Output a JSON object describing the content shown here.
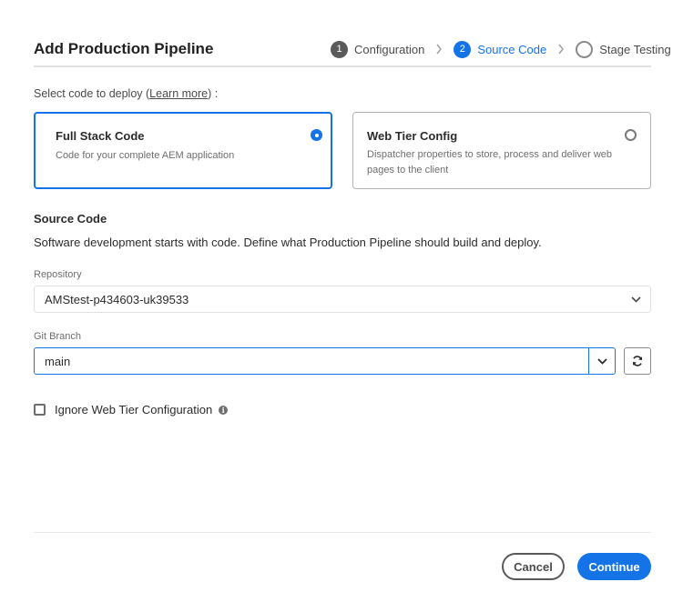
{
  "dialog": {
    "title": "Add Production Pipeline"
  },
  "steps": [
    {
      "number": "1",
      "label": "Configuration",
      "state": "done"
    },
    {
      "number": "2",
      "label": "Source Code",
      "state": "active"
    },
    {
      "number": "",
      "label": "Stage Testing",
      "state": "todo"
    }
  ],
  "deploy": {
    "prompt_prefix": "Select code to deploy (",
    "learn_more": "Learn more",
    "prompt_suffix": ") :",
    "options": [
      {
        "title": "Full Stack Code",
        "description": "Code for your complete AEM application",
        "selected": true
      },
      {
        "title": "Web Tier Config",
        "description": "Dispatcher properties to store, process and deliver web pages to the client",
        "selected": false
      }
    ]
  },
  "source_code": {
    "title": "Source Code",
    "description": "Software development starts with code. Define what Production Pipeline should build and deploy.",
    "repository_label": "Repository",
    "repository_value": "AMStest-p434603-uk39533",
    "branch_label": "Git Branch",
    "branch_value": "main",
    "ignore_label": "Ignore Web Tier Configuration",
    "ignore_checked": false
  },
  "footer": {
    "cancel_label": "Cancel",
    "continue_label": "Continue"
  },
  "colors": {
    "accent": "#1473e6",
    "step_done": "#5a5a5a"
  }
}
